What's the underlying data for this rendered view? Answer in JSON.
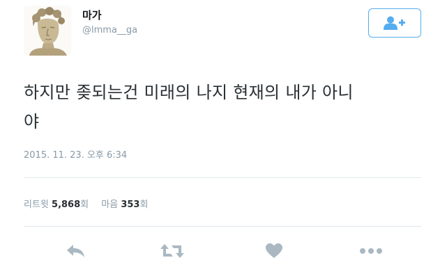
{
  "user": {
    "display_name": "마가",
    "handle": "@lmma__ga",
    "avatar_icon": "marble-statue-bust-avatar"
  },
  "follow_button": {
    "icon": "add-user-icon",
    "color": "#55acee"
  },
  "tweet": {
    "text_line1": "하지만 좆되는건 미래의 나지 현재의 내가 아니",
    "text_line2": "야",
    "timestamp": "2015. 11. 23. 오후 6:34"
  },
  "stats": {
    "retweets_label": "리트윗",
    "retweets_count": "5,868",
    "retweets_suffix": "회",
    "likes_label": "마음",
    "likes_count": "353",
    "likes_suffix": "회"
  },
  "actions": {
    "reply_icon": "reply-icon",
    "retweet_icon": "retweet-icon",
    "like_icon": "heart-icon",
    "more_icon": "more-dots-icon",
    "icon_color": "#aab8c2"
  }
}
